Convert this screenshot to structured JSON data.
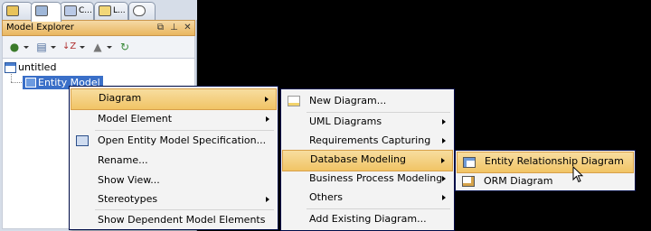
{
  "tabs": [
    {
      "label": "",
      "icon": "package-icon"
    },
    {
      "label": "",
      "icon": "model-icon"
    },
    {
      "label": "C...",
      "icon": "class-icon"
    },
    {
      "label": "L...",
      "icon": "layers-icon"
    },
    {
      "label": "",
      "icon": "search-icon"
    }
  ],
  "panel": {
    "title": "Model Explorer",
    "controls": {
      "restore": "⧉",
      "pin": "⊥",
      "close": "✕"
    }
  },
  "toolbar": {
    "icons": [
      "new-model-icon",
      "model-structure-icon",
      "sort-icon",
      "up-icon",
      "refresh-icon"
    ]
  },
  "tree": {
    "root": "untitled",
    "child": "Entity Model"
  },
  "context_menu": {
    "items": [
      {
        "label": "Diagram",
        "submenu": true,
        "highlighted": true
      },
      {
        "label": "Model Element",
        "submenu": true
      },
      {
        "label": "Open Entity Model Specification...",
        "icon": "specification-icon"
      },
      {
        "label": "Rename..."
      },
      {
        "label": "Show View..."
      },
      {
        "label": "Stereotypes",
        "submenu": true
      },
      {
        "label": "Show Dependent Model Elements"
      }
    ]
  },
  "diagram_submenu": {
    "items": [
      {
        "label": "New Diagram...",
        "icon": "new-diagram-icon"
      },
      {
        "label": "UML Diagrams",
        "submenu": true
      },
      {
        "label": "Requirements Capturing",
        "submenu": true
      },
      {
        "label": "Database Modeling",
        "submenu": true,
        "highlighted": true
      },
      {
        "label": "Business Process Modeling",
        "submenu": true
      },
      {
        "label": "Others",
        "submenu": true
      },
      {
        "label": "Add Existing Diagram..."
      }
    ]
  },
  "database_submenu": {
    "items": [
      {
        "label": "Entity Relationship Diagram",
        "icon": "erd-icon",
        "highlighted": true
      },
      {
        "label": "ORM Diagram",
        "icon": "orm-icon"
      }
    ]
  },
  "colors": {
    "menu_highlight": "#f1c465",
    "selection": "#3a6fc8",
    "panel_title": "#e9b65f"
  }
}
